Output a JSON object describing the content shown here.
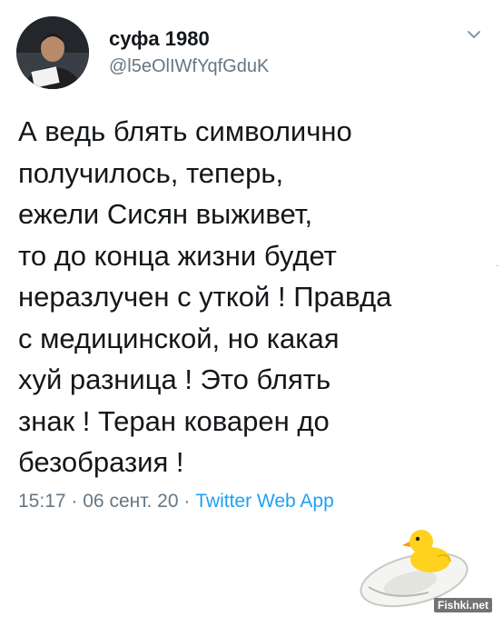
{
  "tweet": {
    "display_name": "суфа 1980",
    "handle": "@l5eOlIWfYqfGduK",
    "text": "А ведь блять символично\nполучилось, теперь,\nежели Сисян выживет,\nто до конца жизни будет\nнеразлучен с уткой ! Правда\nс медицинской, но какая\nхуй разница ! Это блять\nзнак ! Теран коварен до\nбезобразия !",
    "time": "15:17",
    "separator": "·",
    "date": "06 сент. 20",
    "source": "Twitter Web App",
    "menu_icon": "chevron-down-icon",
    "avatar_icon": "avatar-photo"
  },
  "watermark": "Fishki.net",
  "colors": {
    "text": "#14171a",
    "secondary": "#657786",
    "link": "#1da1f2",
    "duck": "#ffd21f",
    "beak": "#f39a1e"
  }
}
